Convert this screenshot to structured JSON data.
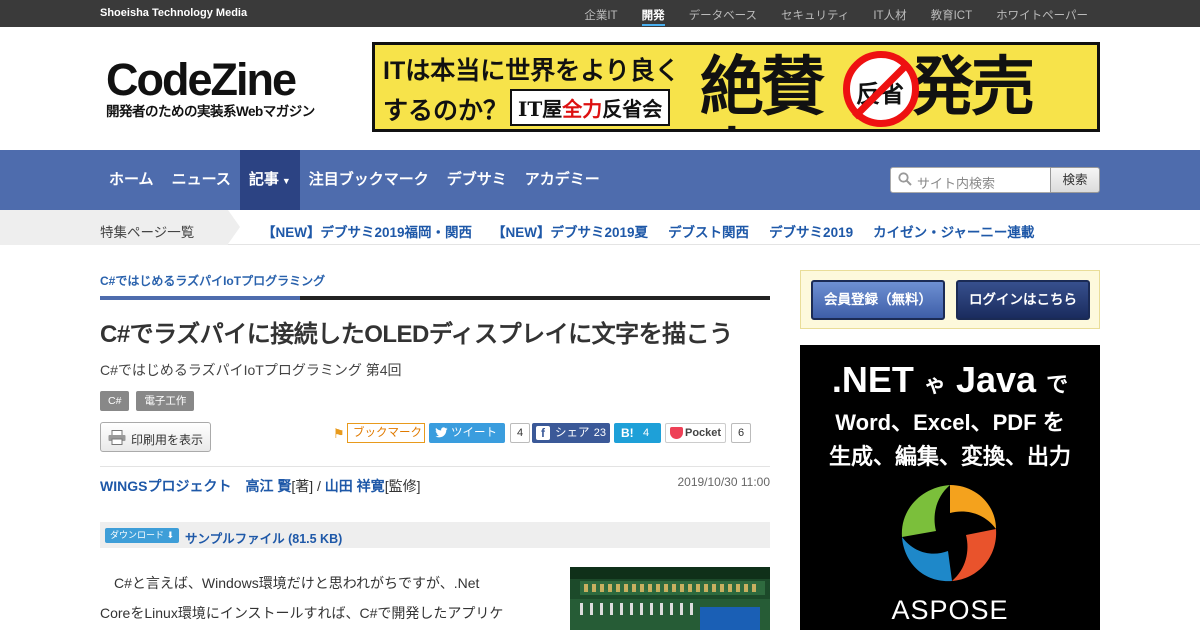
{
  "topbar": {
    "brand": "Shoeisha Technology Media",
    "sites": [
      "企業IT",
      "開発",
      "データベース",
      "セキュリティ",
      "IT人材",
      "教育ICT",
      "ホワイトペーパー"
    ],
    "active_site": "開発"
  },
  "logo": {
    "name": "CodeZine",
    "tagline": "開発者のための実装系Webマガジン"
  },
  "banner": {
    "line1": "ITは本当に世界をより良く",
    "line2": "するのか？",
    "book_prefix": "IT屋",
    "book_red": "全力",
    "book_suffix": "反省会",
    "big_left": "絶賛",
    "sign_char": "反省",
    "big_right": "発売中!"
  },
  "nav": {
    "items": [
      "ホーム",
      "ニュース",
      "記事",
      "注目ブックマーク",
      "デブサミ",
      "アカデミー"
    ],
    "active": "記事",
    "search_placeholder": "サイト内検索",
    "search_button": "検索"
  },
  "features": {
    "label": "特集ページ一覧",
    "links": [
      "【NEW】デブサミ2019福岡・関西",
      "【NEW】デブサミ2019夏",
      "デブスト関西",
      "デブサミ2019",
      "カイゼン・ジャーニー連載"
    ]
  },
  "article": {
    "series": "C#ではじめるラズパイIoTプログラミング",
    "title": "C#でラズパイに接続したOLEDディスプレイに文字を描こう",
    "subtitle": "C#ではじめるラズパイIoTプログラミング 第4回",
    "tags": [
      "C#",
      "電子工作"
    ],
    "print_label": "印刷用を表示",
    "share": {
      "bookmark_label": "ブックマーク",
      "tweet_label": "ツイート",
      "tweet_count": "4",
      "fb_label": "シェア",
      "fb_count": "23",
      "hatena_label": "B!",
      "hatena_count": "4",
      "pocket_label": "Pocket",
      "pocket_count": "6"
    },
    "author1": "WINGSプロジェクト　高江 賢",
    "author1_role": "[著] / ",
    "author2": "山田 祥寛",
    "author2_role": "[監修]",
    "date": "2019/10/30 11:00",
    "download_badge": "ダウンロード ⬇",
    "download_file": "サンプルファイル (81.5 KB)",
    "body_line1": "　C#と言えば、Windows環境だけと思われがちですが、.Net",
    "body_line2": "CoreをLinux環境にインストールすれば、C#で開発したアプリケ"
  },
  "sidebar": {
    "register": "会員登録（無料）",
    "login": "ログインはこちら",
    "ad": {
      "line1_a": ".NET",
      "line1_b": "ゃ",
      "line1_c": "Java",
      "line1_d": "で",
      "line2": "Word、Excel、PDF を",
      "line3": "生成、編集、変換、出力",
      "brand": "ASPOSE"
    }
  },
  "colors": {
    "nav_bg": "#4e6cad",
    "nav_active": "#2c4383",
    "link": "#1e58a8",
    "banner_bg": "#f7e34a"
  }
}
